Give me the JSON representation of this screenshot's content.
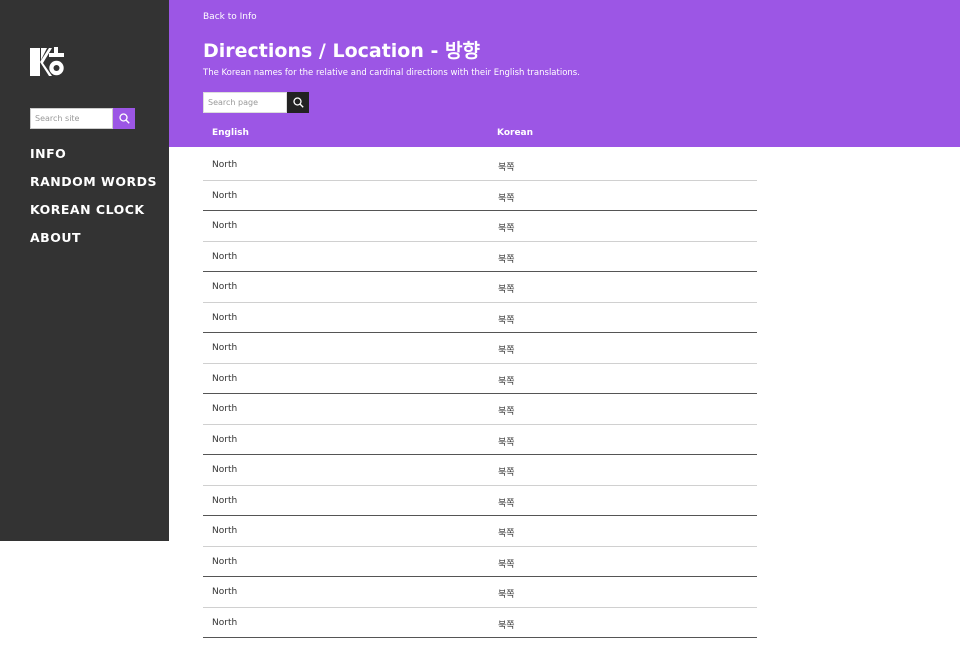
{
  "sidebar": {
    "search_placeholder": "Search site",
    "nav": [
      "INFO",
      "RANDOM WORDS",
      "KOREAN CLOCK",
      "ABOUT"
    ]
  },
  "header": {
    "back_link": "Back to Info",
    "title": "Directions / Location - 방향",
    "description": "The Korean names for the relative and cardinal directions with their English translations.",
    "search_placeholder": "Search page"
  },
  "table": {
    "columns": [
      "English",
      "Korean"
    ],
    "rows": [
      [
        "North",
        "북쪽"
      ],
      [
        "North",
        "북쪽"
      ],
      [
        "North",
        "북쪽"
      ],
      [
        "North",
        "북쪽"
      ],
      [
        "North",
        "북쪽"
      ],
      [
        "North",
        "북쪽"
      ],
      [
        "North",
        "북쪽"
      ],
      [
        "North",
        "북쪽"
      ],
      [
        "North",
        "북쪽"
      ],
      [
        "North",
        "북쪽"
      ],
      [
        "North",
        "북쪽"
      ],
      [
        "North",
        "북쪽"
      ],
      [
        "North",
        "북쪽"
      ],
      [
        "North",
        "북쪽"
      ],
      [
        "North",
        "북쪽"
      ],
      [
        "North",
        "북쪽"
      ]
    ]
  },
  "colors": {
    "accent": "#9c56e5",
    "sidebar_bg": "#333333",
    "search_button_dark": "#222222"
  },
  "icons": {
    "logo": "site-logo",
    "site_search": "search-icon",
    "page_search": "search-icon"
  }
}
